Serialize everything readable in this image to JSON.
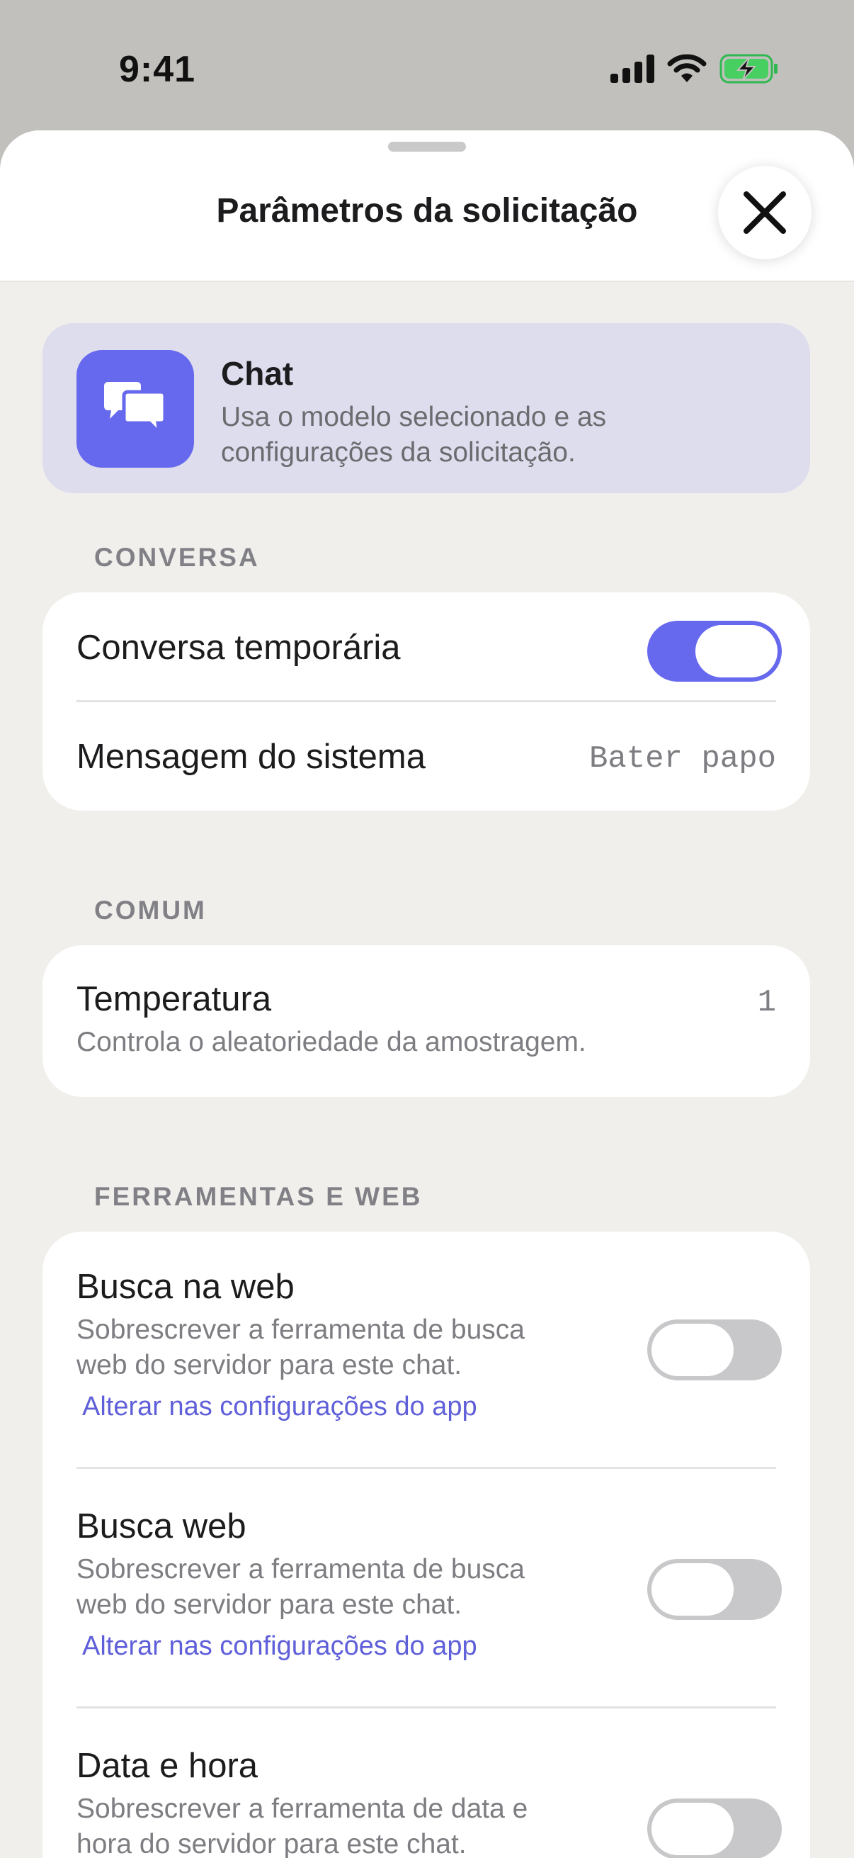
{
  "status_bar": {
    "time": "9:41"
  },
  "sheet": {
    "title": "Parâmetros da solicitação",
    "close_icon": "close-x-icon"
  },
  "mode": {
    "title": "Chat",
    "description": "Usa o modelo selecionado e as configurações da solicitação.",
    "icon": "chat-bubbles-icon",
    "accent": "#6668ee"
  },
  "sections": {
    "conversa": {
      "header": "CONVERSA",
      "temporary_label": "Conversa temporária",
      "temporary_on": true,
      "system_label": "Mensagem do sistema",
      "system_value": "Bater papo"
    },
    "comum": {
      "header": "COMUM",
      "temperature_label": "Temperatura",
      "temperature_desc": "Controla o aleatoriedade da amostragem.",
      "temperature_value": "1"
    },
    "tools": {
      "header": "FERRAMENTAS E WEB",
      "items": [
        {
          "label": "Busca na web",
          "desc_line1": "Sobrescrever a ferramenta de busca",
          "desc_line2": "web do servidor para este chat.",
          "link": "Alterar nas configurações do app",
          "on": false
        },
        {
          "label": "Busca web",
          "desc_line1": "Sobrescrever a ferramenta de busca",
          "desc_line2": "web do servidor para este chat.",
          "link": "Alterar nas configurações do app",
          "on": false
        },
        {
          "label": "Data e hora",
          "desc_line1": "Sobrescrever a ferramenta de data e",
          "desc_line2": "hora do servidor para este chat.",
          "on": false
        }
      ]
    }
  }
}
